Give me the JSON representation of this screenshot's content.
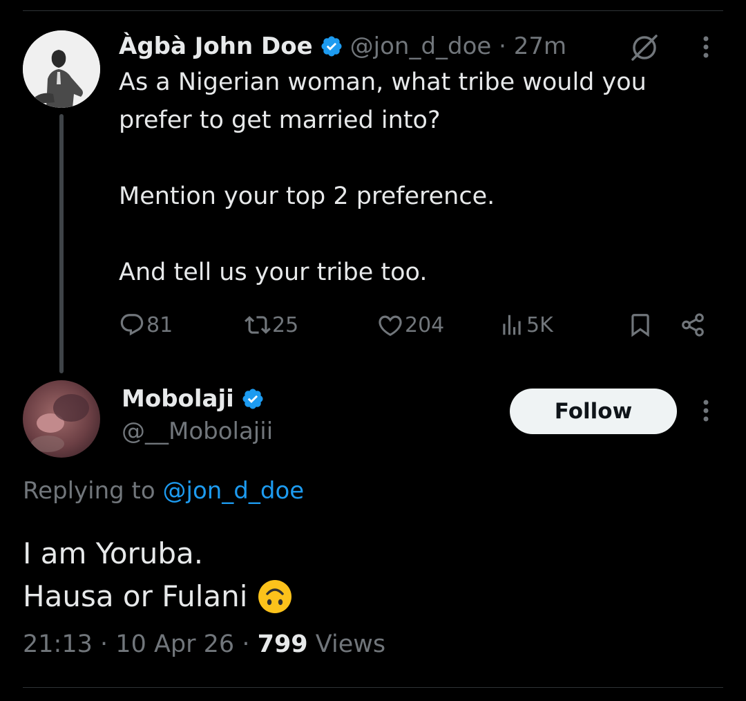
{
  "original_post": {
    "author_name": "Àgbà John Doe",
    "handle": "@jon_d_doe",
    "separator": "·",
    "time": "27m",
    "lines": [
      "As a Nigerian woman, what tribe would you",
      "prefer to get married into?",
      "",
      "Mention your top 2 preference.",
      "",
      "And tell us your tribe too."
    ],
    "stats": {
      "replies": "81",
      "reposts": "25",
      "likes": "204",
      "views": "5K"
    }
  },
  "reply": {
    "author_name": "Mobolaji",
    "handle": "@__Mobolajii",
    "follow_label": "Follow",
    "replying_prefix": "Replying to",
    "replying_handle": "@jon_d_doe",
    "lines": [
      "I am Yoruba.",
      "Hausa or Fulani"
    ],
    "emoji": "upside-down-face",
    "time": "21:13",
    "date": "10 Apr 26",
    "separator": "·",
    "views_count": "799",
    "views_label": "Views"
  },
  "colors": {
    "background": "#000000",
    "text": "#e7e9ea",
    "secondary": "#71767b",
    "accent": "#1d9bf0",
    "divider": "#2f3336"
  }
}
